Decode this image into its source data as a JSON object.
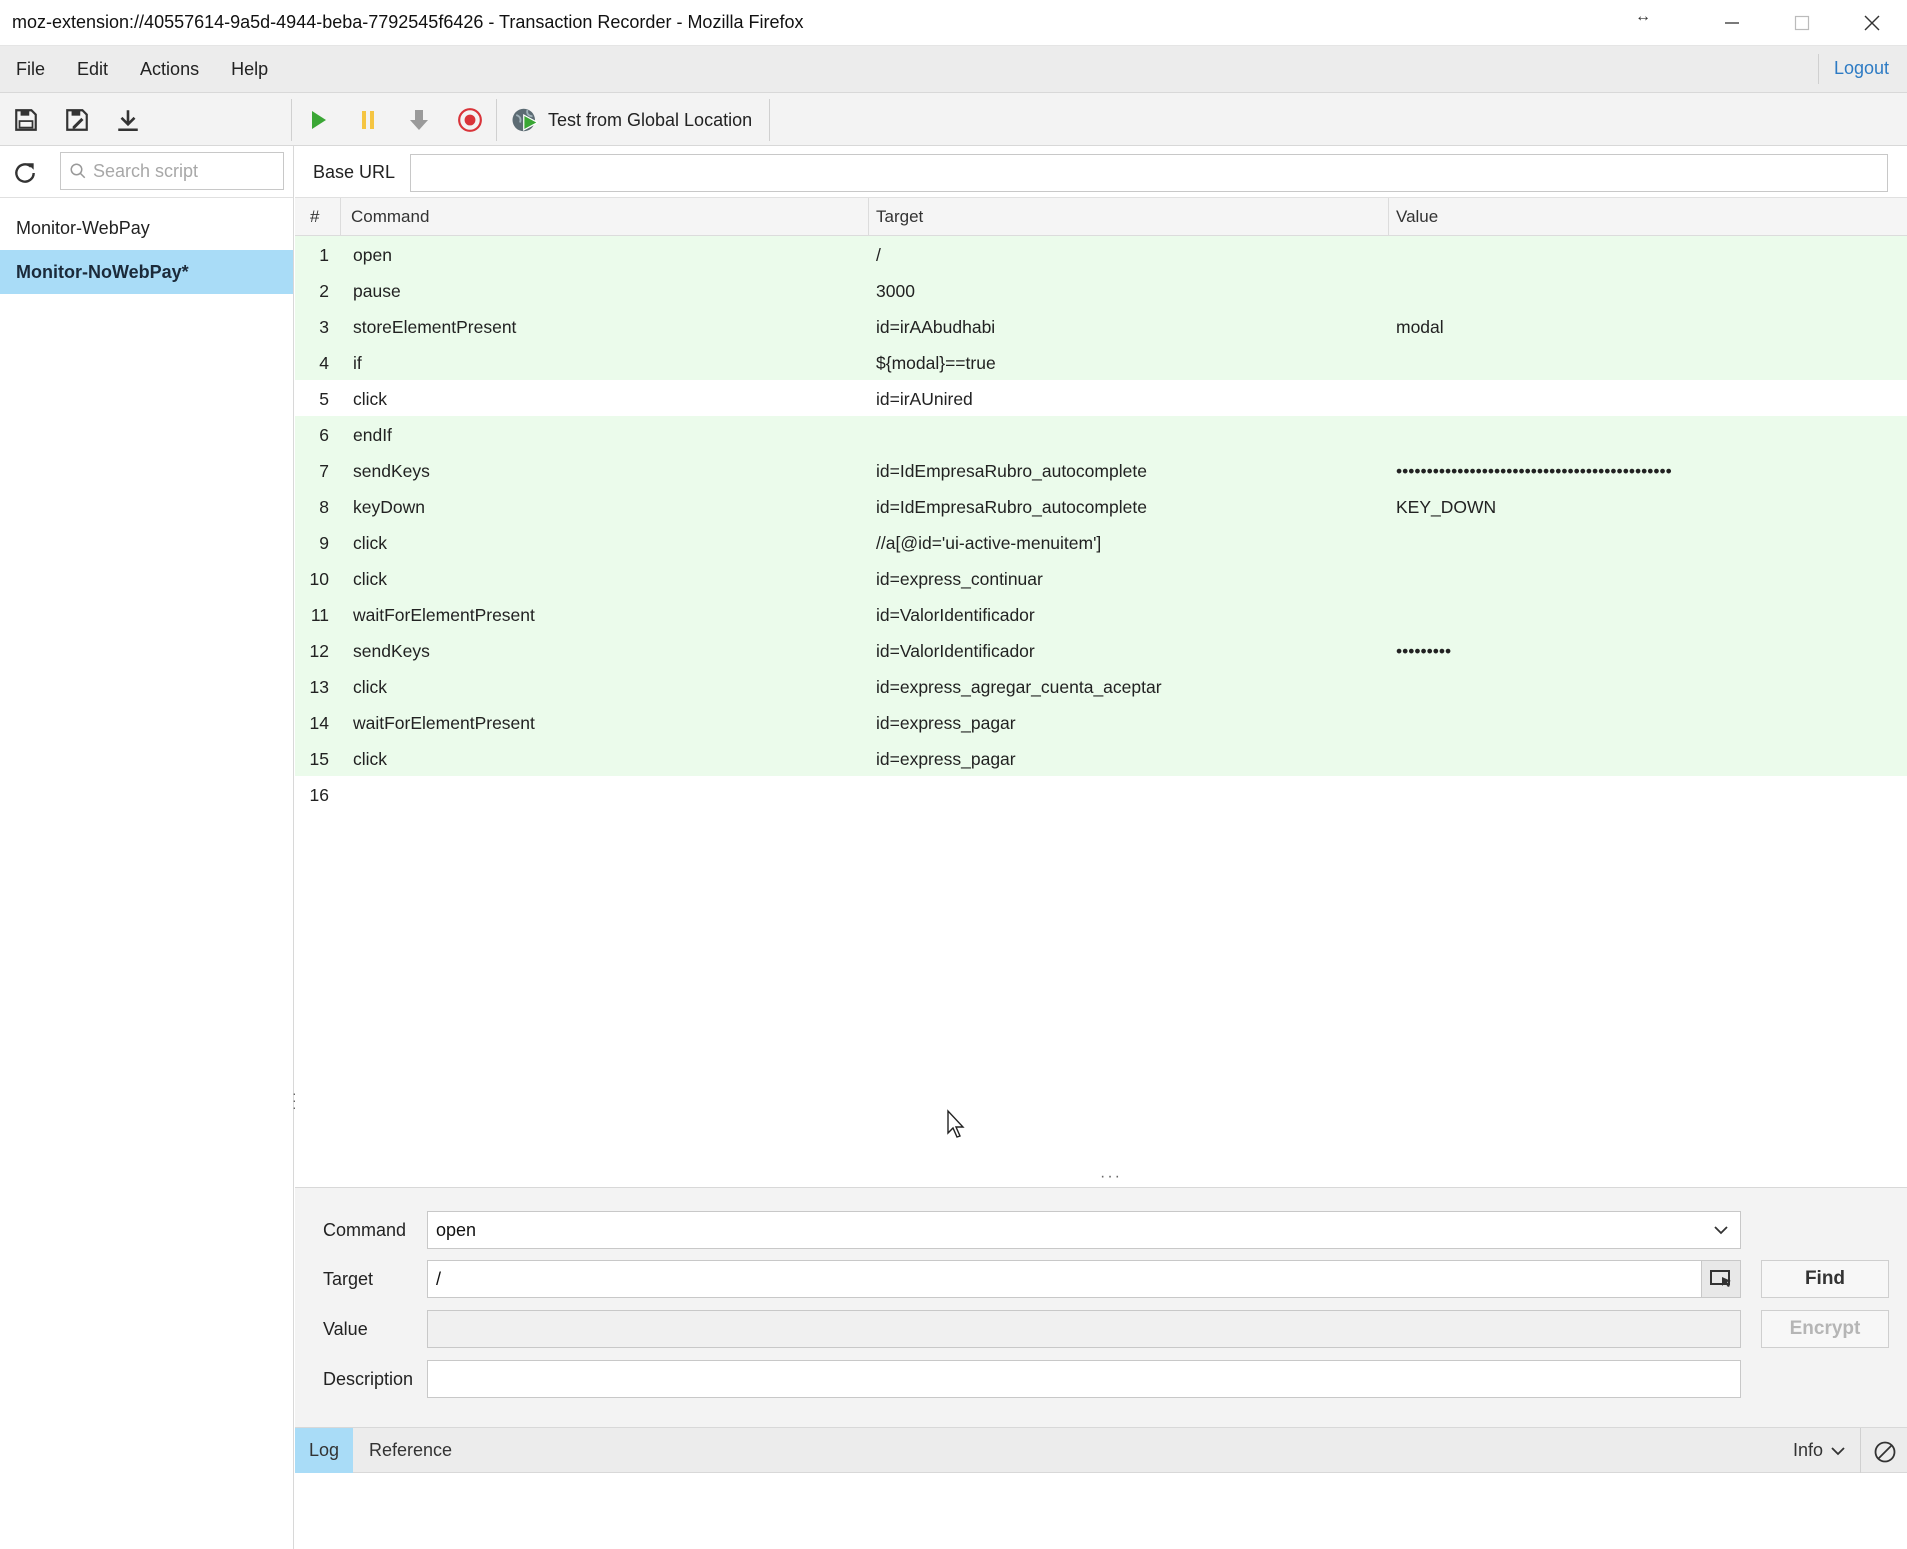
{
  "window": {
    "title": "moz-extension://40557614-9a5d-4944-beba-7792545f6426 - Transaction Recorder - Mozilla Firefox",
    "resize_glyph": "↔"
  },
  "menu": {
    "items": [
      "File",
      "Edit",
      "Actions",
      "Help"
    ],
    "logout": "Logout"
  },
  "toolbar": {
    "test_global_label": "Test from Global Location"
  },
  "sidebar": {
    "search_placeholder": "Search script",
    "scripts": [
      {
        "name": "Monitor-WebPay",
        "active": false
      },
      {
        "name": "Monitor-NoWebPay*",
        "active": true
      }
    ]
  },
  "base_url": {
    "label": "Base URL",
    "value": ""
  },
  "table": {
    "headers": {
      "num": "#",
      "command": "Command",
      "target": "Target",
      "value": "Value"
    },
    "rows": [
      {
        "num": "1",
        "command": "open",
        "target": "/",
        "value": "",
        "green": true
      },
      {
        "num": "2",
        "command": "pause",
        "target": "3000",
        "value": "",
        "green": true
      },
      {
        "num": "3",
        "command": "storeElementPresent",
        "target": "id=irAAbudhabi",
        "value": "modal",
        "green": true
      },
      {
        "num": "4",
        "command": "if",
        "target": "${modal}==true",
        "value": "",
        "green": true
      },
      {
        "num": "5",
        "command": "click",
        "target": "id=irAUnired",
        "value": "",
        "green": false
      },
      {
        "num": "6",
        "command": "endIf",
        "target": "",
        "value": "",
        "green": true
      },
      {
        "num": "7",
        "command": "sendKeys",
        "target": "id=IdEmpresaRubro_autocomplete",
        "value": "•••••••••••••••••••••••••••••••••••••••••••••",
        "green": true
      },
      {
        "num": "8",
        "command": "keyDown",
        "target": "id=IdEmpresaRubro_autocomplete",
        "value": "KEY_DOWN",
        "green": true
      },
      {
        "num": "9",
        "command": "click",
        "target": "//a[@id='ui-active-menuitem']",
        "value": "",
        "green": true
      },
      {
        "num": "10",
        "command": "click",
        "target": "id=express_continuar",
        "value": "",
        "green": true
      },
      {
        "num": "11",
        "command": "waitForElementPresent",
        "target": "id=ValorIdentificador",
        "value": "",
        "green": true
      },
      {
        "num": "12",
        "command": "sendKeys",
        "target": "id=ValorIdentificador",
        "value": "•••••••••",
        "green": true
      },
      {
        "num": "13",
        "command": "click",
        "target": "id=express_agregar_cuenta_aceptar",
        "value": "",
        "green": true
      },
      {
        "num": "14",
        "command": "waitForElementPresent",
        "target": "id=express_pagar",
        "value": "",
        "green": true
      },
      {
        "num": "15",
        "command": "click",
        "target": "id=express_pagar",
        "value": "",
        "green": true
      },
      {
        "num": "16",
        "command": "",
        "target": "",
        "value": "",
        "green": false
      }
    ]
  },
  "editor": {
    "command_label": "Command",
    "command_value": "open",
    "target_label": "Target",
    "target_value": "/",
    "value_label": "Value",
    "value_value": "",
    "description_label": "Description",
    "description_value": "",
    "find_label": "Find",
    "encrypt_label": "Encrypt"
  },
  "log": {
    "tabs": [
      "Log",
      "Reference"
    ],
    "active_tab": "Log",
    "level": "Info"
  },
  "colors": {
    "accent_selected": "#a9dcf7",
    "row_green": "#ebfbeb",
    "link_blue": "#2d7bc4",
    "play_green": "#3aa635",
    "pause_yellow": "#f5c542",
    "record_red": "#d9343a"
  }
}
